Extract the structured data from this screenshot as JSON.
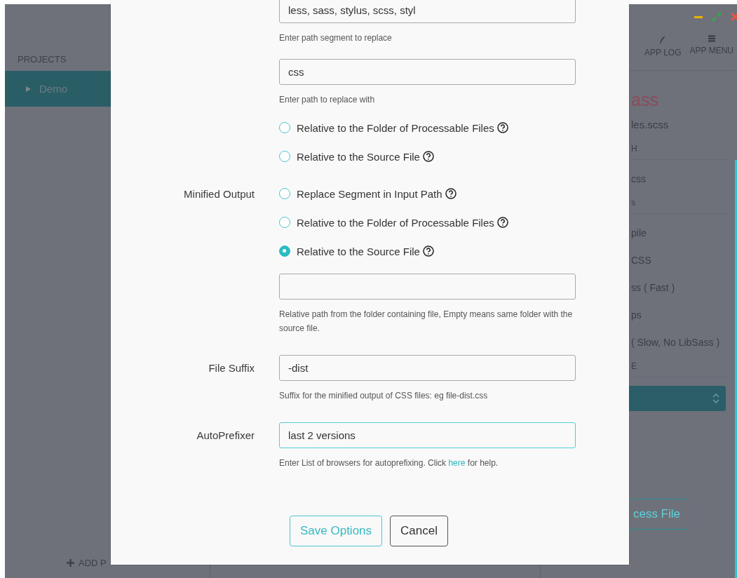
{
  "sidebar": {
    "heading": "PROJECTS",
    "projects": [
      {
        "name": "Demo",
        "selected": true
      }
    ],
    "add_button": "ADD P"
  },
  "toolbar": {
    "buttons": [
      {
        "label": "APP LOG"
      },
      {
        "label": "APP MENU"
      }
    ]
  },
  "panel": {
    "title": "ass",
    "file": "les.scss",
    "items": [
      {
        "kind": "heading",
        "text": "H"
      },
      {
        "kind": "option",
        "text": "css"
      },
      {
        "kind": "heading",
        "text": "s"
      },
      {
        "kind": "option",
        "text": "pile"
      },
      {
        "kind": "option",
        "text": "CSS"
      },
      {
        "kind": "option",
        "text": "ss ( Fast )"
      },
      {
        "kind": "option",
        "text": "ps"
      },
      {
        "kind": "option",
        "text": "( Slow, No LibSass )"
      },
      {
        "kind": "heading",
        "text": "E"
      }
    ],
    "process_button": "cess File"
  },
  "modal": {
    "rows": [
      {
        "kind": "input",
        "value": "less, sass, stylus, scss, styl",
        "focused": false
      },
      {
        "kind": "help",
        "text": "Enter path segment to replace"
      },
      {
        "kind": "input",
        "value": "css",
        "focused": false
      },
      {
        "kind": "help",
        "text": "Enter path to replace with"
      },
      {
        "kind": "radio",
        "text": "Relative to the Folder of Processable Files",
        "selected": false
      },
      {
        "kind": "radio",
        "text": "Relative to the Source File",
        "selected": false
      },
      {
        "kind": "radio",
        "label": "Minified Output",
        "text": "Replace Segment in Input Path",
        "selected": false
      },
      {
        "kind": "radio",
        "text": "Relative to the Folder of Processable Files",
        "selected": false
      },
      {
        "kind": "radio",
        "text": "Relative to the Source File",
        "selected": true
      },
      {
        "kind": "input",
        "focused": false
      },
      {
        "kind": "help",
        "text": "Relative path from the folder containing file, Empty means same folder with the source file."
      },
      {
        "kind": "input",
        "label": "File Suffix",
        "value": "-dist",
        "focused": false
      },
      {
        "kind": "help",
        "text": "Suffix for the minified output of CSS files: eg file-dist.css"
      },
      {
        "kind": "input",
        "label": "AutoPrefixer",
        "value": "last 2 versions",
        "focused": true
      },
      {
        "kind": "help",
        "text": "Enter List of browsers for autoprefixing. Click ",
        "link": "here",
        "text_after": " for help."
      }
    ],
    "buttons": [
      {
        "label": "Save Options",
        "kind": "primary"
      },
      {
        "label": "Cancel",
        "kind": "secondary"
      }
    ]
  }
}
